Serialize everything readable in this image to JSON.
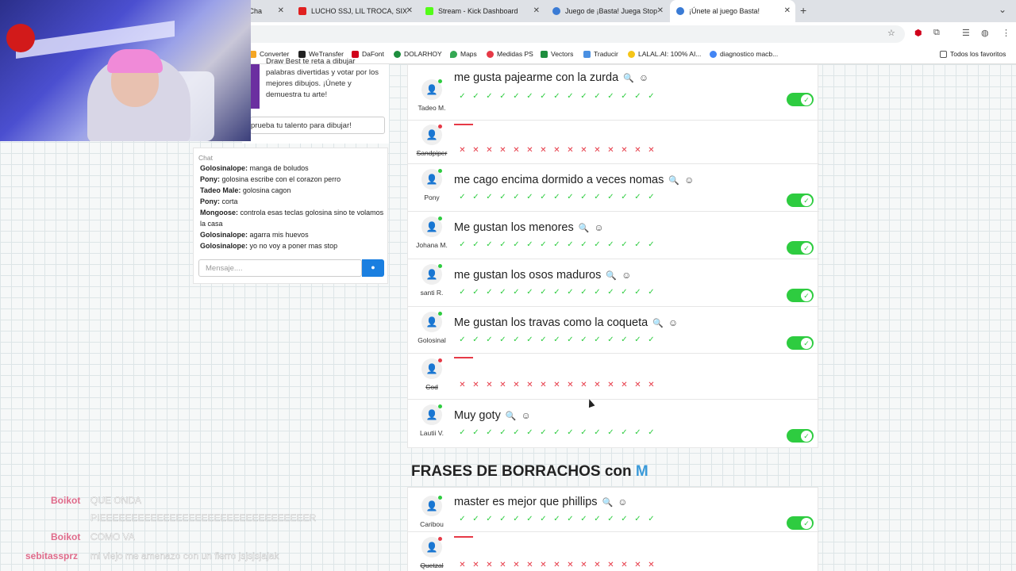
{
  "tabs": [
    {
      "label": "- Cha",
      "fav": "#888"
    },
    {
      "label": "LUCHO SSJ, LIL TROCA, SIX",
      "fav": "#e02020"
    },
    {
      "label": "Stream - Kick Dashboard",
      "fav": "#53fc18"
    },
    {
      "label": "Juego de ¡Basta! Juega Stop",
      "fav": "#3a7bd5"
    },
    {
      "label": "¡Únete al juego Basta!",
      "fav": "#3a7bd5"
    }
  ],
  "bookmarks": [
    {
      "label": "Converter",
      "color": "#f5a623"
    },
    {
      "label": "WeTransfer",
      "color": "#222"
    },
    {
      "label": "DaFont",
      "color": "#d0021b"
    },
    {
      "label": "DOLARHOY",
      "color": "#1e8e3e"
    },
    {
      "label": "Maps",
      "color": "#34a853"
    },
    {
      "label": "Medidas PS",
      "color": "#e63946"
    },
    {
      "label": "Vectors",
      "color": "#1e8e3e"
    },
    {
      "label": "Traducir",
      "color": "#4a90e2"
    },
    {
      "label": "LALAL.AI: 100% AI...",
      "color": "#f5c518"
    },
    {
      "label": "diagnostico macb...",
      "color": "#4285f4"
    },
    {
      "label": "Todos los favoritos",
      "color": "#888"
    }
  ],
  "promo": {
    "text": "Draw Best te reta a dibujar palabras divertidas y votar por los mejores dibujos. ¡Únete y demuestra tu arte!",
    "button": "prueba tu talento para dibujar!"
  },
  "chat": {
    "title": "Chat",
    "messages": [
      {
        "user": "Golosinalope:",
        "text": "manga de boludos"
      },
      {
        "user": "Pony:",
        "text": "golosina escribe con el corazon perro"
      },
      {
        "user": "Tadeo Male:",
        "text": "golosina cagon"
      },
      {
        "user": "Pony:",
        "text": "corta"
      },
      {
        "user": "Mongoose:",
        "text": "controla esas teclas golosina sino te volamos la casa"
      },
      {
        "user": "Golosinalope:",
        "text": "agarra mis huevos"
      },
      {
        "user": "Golosinalope:",
        "text": "yo no voy a poner mas stop"
      }
    ],
    "placeholder": "Mensaje...."
  },
  "rows": [
    {
      "name": "Tadeo M.",
      "answer": "me gusta pajearme con la zurda",
      "valid": true
    },
    {
      "name": "Sandpiper",
      "answer": "",
      "valid": false
    },
    {
      "name": "Pony",
      "answer": "me cago encima dormido a veces nomas",
      "valid": true
    },
    {
      "name": "Johana M.",
      "answer": "Me gustan los menores",
      "valid": true
    },
    {
      "name": "santi R.",
      "answer": "me gustan los osos maduros",
      "valid": true
    },
    {
      "name": "Golosinal",
      "answer": "Me gustan los travas como la coqueta",
      "valid": true
    },
    {
      "name": "Cod",
      "answer": "",
      "valid": false
    },
    {
      "name": "Lautii V.",
      "answer": "Muy goty",
      "valid": true
    }
  ],
  "section": {
    "title": "FRASES DE BORRACHOS con",
    "letter": "M"
  },
  "rows2": [
    {
      "name": "Caribou",
      "answer": "master es mejor que phillips",
      "valid": true
    },
    {
      "name": "Quetzal",
      "answer": "",
      "valid": false
    }
  ],
  "overlay": [
    {
      "user": "Boikot",
      "text": "QUE ONDA"
    },
    {
      "user": "",
      "text": "PIEEEEEEEEEEEEEEEEEEEEEEEEEEEEEEEEER"
    },
    {
      "user": "Boikot",
      "text": "COMO VA"
    },
    {
      "user": "sebitassprz",
      "text": "mi viejo me amenazo con un fierro jsjsjsjajak"
    }
  ]
}
